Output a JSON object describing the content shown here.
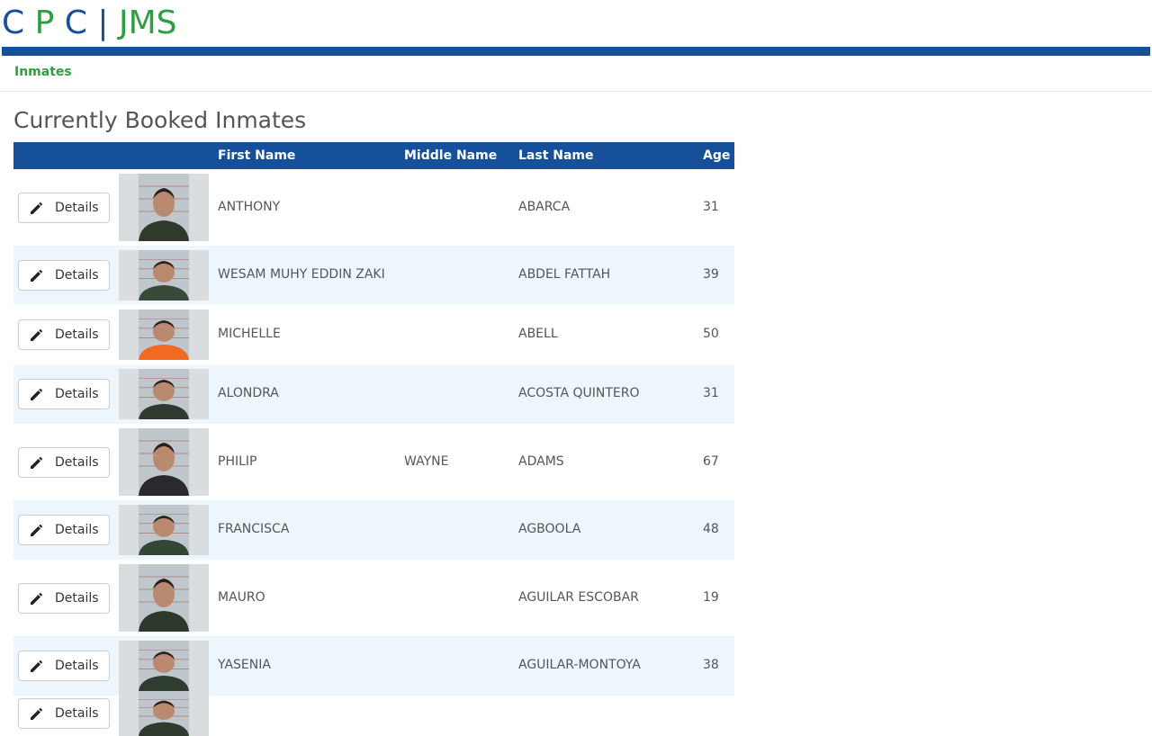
{
  "brand": {
    "letters": [
      "C",
      "P",
      "C",
      "|",
      "JMS"
    ]
  },
  "nav": {
    "inmates_link": "Inmates"
  },
  "page": {
    "title": "Currently Booked Inmates"
  },
  "table": {
    "headers": {
      "first": "First Name",
      "middle": "Middle Name",
      "last": "Last Name",
      "age": "Age"
    },
    "details_label": "Details",
    "rows": [
      {
        "first": "ANTHONY",
        "middle": "",
        "last": "ABARCA",
        "age": "31",
        "shirt": "#2f3a2c"
      },
      {
        "first": "WESAM MUHY EDDIN ZAKI",
        "middle": "",
        "last": "ABDEL FATTAH",
        "age": "39",
        "shirt": "#3a4a3a"
      },
      {
        "first": "MICHELLE",
        "middle": "",
        "last": "ABELL",
        "age": "50",
        "shirt": "#f26a21"
      },
      {
        "first": "ALONDRA",
        "middle": "",
        "last": "ACOSTA QUINTERO",
        "age": "31",
        "shirt": "#2d3a2d"
      },
      {
        "first": "PHILIP",
        "middle": "WAYNE",
        "last": "ADAMS",
        "age": "67",
        "shirt": "#2a2a2e"
      },
      {
        "first": "FRANCISCA",
        "middle": "",
        "last": "AGBOOLA",
        "age": "48",
        "shirt": "#354536"
      },
      {
        "first": "MAURO",
        "middle": "",
        "last": "AGUILAR ESCOBAR",
        "age": "19",
        "shirt": "#2b3a2b"
      },
      {
        "first": "YASENIA",
        "middle": "",
        "last": "AGUILAR-MONTOYA",
        "age": "38",
        "shirt": "#2f3d30"
      },
      {
        "first": "",
        "middle": "",
        "last": "",
        "age": "",
        "shirt": "#2f3a2f"
      }
    ]
  },
  "colors": {
    "brand_blue": "#17509a",
    "brand_green": "#2e9e40",
    "row_alt": "#eef6fd"
  }
}
